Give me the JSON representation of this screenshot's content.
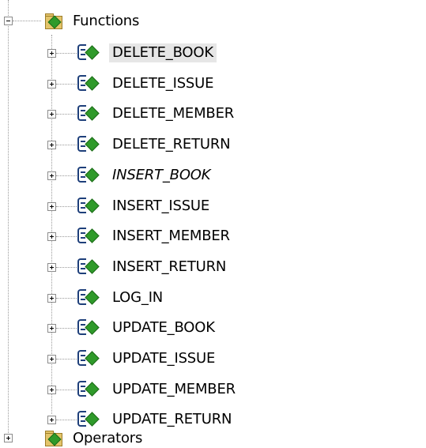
{
  "tree": {
    "folder": {
      "label": "Functions",
      "icon": "functions-folder-icon"
    },
    "items": [
      {
        "label": "DELETE_BOOK",
        "selected": true
      },
      {
        "label": "DELETE_ISSUE"
      },
      {
        "label": "DELETE_MEMBER"
      },
      {
        "label": "DELETE_RETURN"
      },
      {
        "label": "INSERT_BOOK",
        "italic": true
      },
      {
        "label": "INSERT_ISSUE"
      },
      {
        "label": "INSERT_MEMBER"
      },
      {
        "label": "INSERT_RETURN"
      },
      {
        "label": "LOG_IN"
      },
      {
        "label": "UPDATE_BOOK"
      },
      {
        "label": "UPDATE_ISSUE"
      },
      {
        "label": "UPDATE_MEMBER"
      },
      {
        "label": "UPDATE_RETURN"
      }
    ],
    "next_folder": {
      "label": "Operators"
    }
  },
  "colors": {
    "selection": "#e6e6e6",
    "icon_blue": "#1e3f7a",
    "icon_green": "#2f9a2a",
    "folder": "#e3c46a"
  }
}
